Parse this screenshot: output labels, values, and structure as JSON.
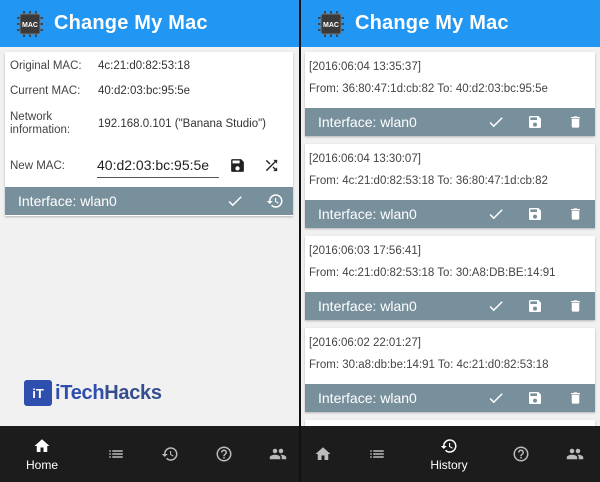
{
  "app": {
    "title": "Change My Mac",
    "logo_text": "MAC"
  },
  "home": {
    "rows": [
      {
        "label": "Original MAC:",
        "value": "4c:21:d0:82:53:18"
      },
      {
        "label": "Current MAC:",
        "value": "40:d2:03:bc:95:5e"
      },
      {
        "label": "Network information:",
        "value": "192.168.0.101 (\"Banana Studio\")"
      }
    ],
    "new_mac_label": "New MAC:",
    "new_mac_value": "40:d2:03:bc:95:5e",
    "interface_label": "Interface: wlan0"
  },
  "watermark": {
    "badge": "iT",
    "part1": "iTech",
    "part2": "Hacks"
  },
  "history": [
    {
      "stamp": "[2016:06:04 13:35:37]",
      "change": "From: 36:80:47:1d:cb:82  To: 40:d2:03:bc:95:5e",
      "interface": "Interface: wlan0"
    },
    {
      "stamp": "[2016:06:04 13:30:07]",
      "change": "From: 4c:21:d0:82:53:18  To: 36:80:47:1d:cb:82",
      "interface": "Interface: wlan0"
    },
    {
      "stamp": "[2016:06:03 17:56:41]",
      "change": "From: 4c:21:d0:82:53:18  To: 30:A8:DB:BE:14:91",
      "interface": "Interface: wlan0"
    },
    {
      "stamp": "[2016:06:02 22:01:27]",
      "change": "From: 30:a8:db:be:14:91  To: 4c:21:d0:82:53:18",
      "interface": "Interface: wlan0"
    }
  ],
  "nav_left": {
    "active_label": "Home"
  },
  "nav_right": {
    "active_label": "History"
  },
  "colors": {
    "appbar": "#2196f3",
    "interface_bar": "#78909c",
    "bottom_nav": "#1c1c1c"
  }
}
